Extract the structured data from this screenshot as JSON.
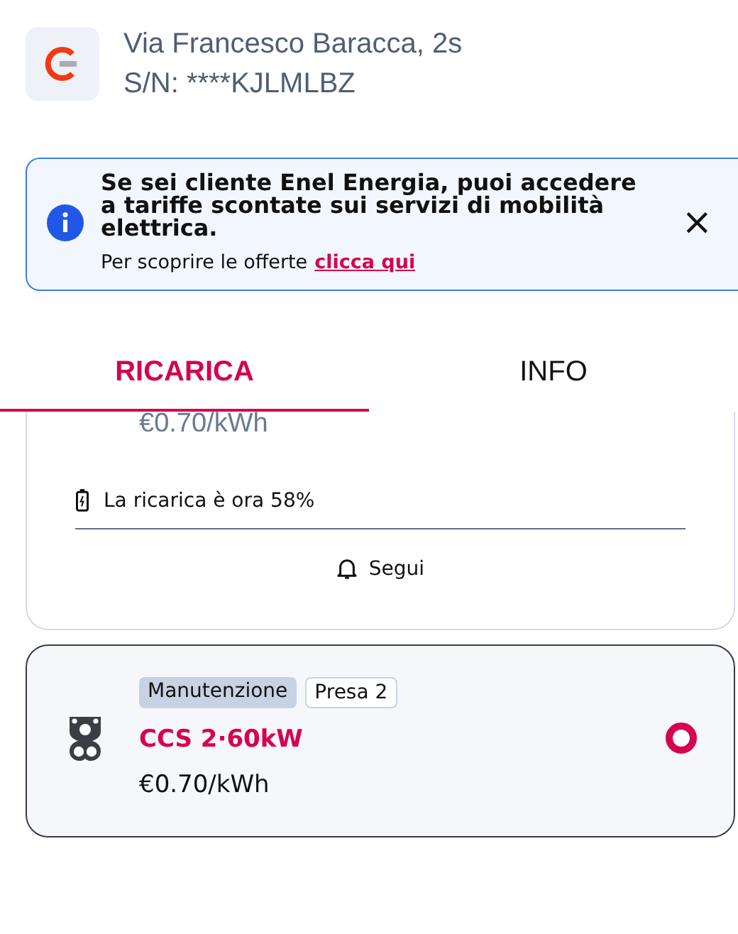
{
  "station": {
    "address": "Via Francesco Baracca, 2s",
    "serial": "S/N: ****KJLMLBZ"
  },
  "banner": {
    "message": "Se sei cliente Enel Energia, puoi accedere a tariffe scontate sui servizi di mobilità elettrica.",
    "prompt": "Per scoprire le offerte",
    "link": "clicca qui",
    "close": "×"
  },
  "tabs": [
    {
      "label": "RICARICA",
      "selected": true
    },
    {
      "label": "INFO",
      "selected": false
    }
  ],
  "current_connector": {
    "price": "€0.70/kWh",
    "charge_status": "La ricarica è ora 58%",
    "follow_button": "Segui"
  },
  "connectors": [
    {
      "tags": [
        {
          "label": "Manutenzione",
          "kind": "status"
        },
        {
          "label": "Presa 2",
          "kind": "socket"
        }
      ],
      "name": "CCS 2·60kW",
      "price": "€0.70/kWh",
      "selected": true
    }
  ]
}
